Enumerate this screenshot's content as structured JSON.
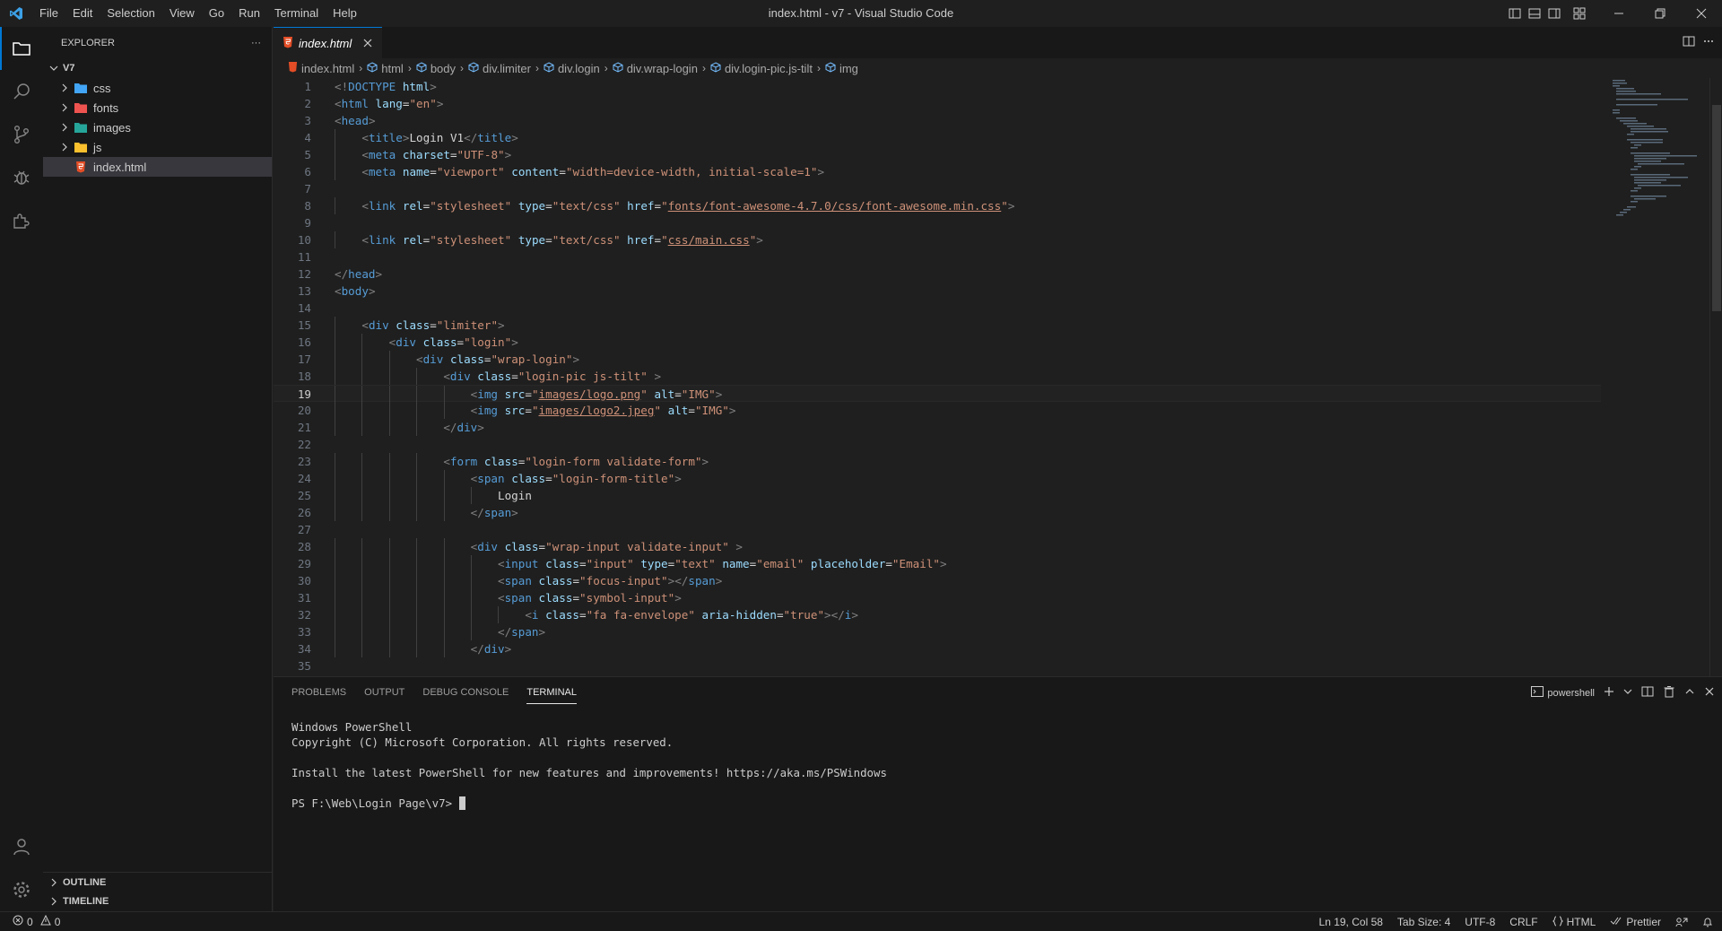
{
  "window": {
    "title": "index.html - v7 - Visual Studio Code",
    "menu": [
      "File",
      "Edit",
      "Selection",
      "View",
      "Go",
      "Run",
      "Terminal",
      "Help"
    ]
  },
  "sidebar": {
    "header": "EXPLORER",
    "more": "···",
    "root": "V7",
    "items": [
      {
        "label": "css",
        "icon": "css-folder-icon",
        "color": "#42a5f5"
      },
      {
        "label": "fonts",
        "icon": "fonts-folder-icon",
        "color": "#ef5350"
      },
      {
        "label": "images",
        "icon": "images-folder-icon",
        "color": "#26a69a"
      },
      {
        "label": "js",
        "icon": "js-folder-icon",
        "color": "#fbc02d"
      },
      {
        "label": "index.html",
        "icon": "html-file-icon",
        "color": "#e44d26"
      }
    ],
    "outline": "OUTLINE",
    "timeline": "TIMELINE"
  },
  "editor": {
    "tab_label": "index.html",
    "breadcrumbs": [
      "index.html",
      "html",
      "body",
      "div.limiter",
      "div.login",
      "div.wrap-login",
      "div.login-pic.js-tilt",
      "img"
    ],
    "current_line": 19,
    "lines": [
      {
        "n": "1",
        "indent": 0,
        "tokens": [
          [
            "tag",
            "<!"
          ],
          [
            "name",
            "DOCTYPE"
          ],
          [
            "text",
            " "
          ],
          [
            "attr",
            "html"
          ],
          [
            "tag",
            ">"
          ]
        ]
      },
      {
        "n": "2",
        "indent": 0,
        "tokens": [
          [
            "tag",
            "<"
          ],
          [
            "name",
            "html"
          ],
          [
            "text",
            " "
          ],
          [
            "attr",
            "lang"
          ],
          [
            "text",
            "="
          ],
          [
            "str",
            "\"en\""
          ],
          [
            "tag",
            ">"
          ]
        ]
      },
      {
        "n": "3",
        "indent": 0,
        "tokens": [
          [
            "tag",
            "<"
          ],
          [
            "name",
            "head"
          ],
          [
            "tag",
            ">"
          ]
        ]
      },
      {
        "n": "4",
        "indent": 1,
        "tokens": [
          [
            "tag",
            "<"
          ],
          [
            "name",
            "title"
          ],
          [
            "tag",
            ">"
          ],
          [
            "text",
            "Login V1"
          ],
          [
            "tag",
            "</"
          ],
          [
            "name",
            "title"
          ],
          [
            "tag",
            ">"
          ]
        ]
      },
      {
        "n": "5",
        "indent": 1,
        "tokens": [
          [
            "tag",
            "<"
          ],
          [
            "name",
            "meta"
          ],
          [
            "text",
            " "
          ],
          [
            "attr",
            "charset"
          ],
          [
            "text",
            "="
          ],
          [
            "str",
            "\"UTF-8\""
          ],
          [
            "tag",
            ">"
          ]
        ]
      },
      {
        "n": "6",
        "indent": 1,
        "tokens": [
          [
            "tag",
            "<"
          ],
          [
            "name",
            "meta"
          ],
          [
            "text",
            " "
          ],
          [
            "attr",
            "name"
          ],
          [
            "text",
            "="
          ],
          [
            "str",
            "\"viewport\""
          ],
          [
            "text",
            " "
          ],
          [
            "attr",
            "content"
          ],
          [
            "text",
            "="
          ],
          [
            "str",
            "\"width=device-width, initial-scale=1\""
          ],
          [
            "tag",
            ">"
          ]
        ]
      },
      {
        "n": "7",
        "indent": 0,
        "tokens": []
      },
      {
        "n": "8",
        "indent": 1,
        "tokens": [
          [
            "tag",
            "<"
          ],
          [
            "name",
            "link"
          ],
          [
            "text",
            " "
          ],
          [
            "attr",
            "rel"
          ],
          [
            "text",
            "="
          ],
          [
            "str",
            "\"stylesheet\""
          ],
          [
            "text",
            " "
          ],
          [
            "attr",
            "type"
          ],
          [
            "text",
            "="
          ],
          [
            "str",
            "\"text/css\""
          ],
          [
            "text",
            " "
          ],
          [
            "attr",
            "href"
          ],
          [
            "text",
            "="
          ],
          [
            "str",
            "\""
          ],
          [
            "link",
            "fonts/font-awesome-4.7.0/css/font-awesome.min.css"
          ],
          [
            "str",
            "\""
          ],
          [
            "tag",
            ">"
          ]
        ]
      },
      {
        "n": "9",
        "indent": 0,
        "tokens": []
      },
      {
        "n": "10",
        "indent": 1,
        "tokens": [
          [
            "tag",
            "<"
          ],
          [
            "name",
            "link"
          ],
          [
            "text",
            " "
          ],
          [
            "attr",
            "rel"
          ],
          [
            "text",
            "="
          ],
          [
            "str",
            "\"stylesheet\""
          ],
          [
            "text",
            " "
          ],
          [
            "attr",
            "type"
          ],
          [
            "text",
            "="
          ],
          [
            "str",
            "\"text/css\""
          ],
          [
            "text",
            " "
          ],
          [
            "attr",
            "href"
          ],
          [
            "text",
            "="
          ],
          [
            "str",
            "\""
          ],
          [
            "link",
            "css/main.css"
          ],
          [
            "str",
            "\""
          ],
          [
            "tag",
            ">"
          ]
        ]
      },
      {
        "n": "11",
        "indent": 0,
        "tokens": []
      },
      {
        "n": "12",
        "indent": 0,
        "tokens": [
          [
            "tag",
            "</"
          ],
          [
            "name",
            "head"
          ],
          [
            "tag",
            ">"
          ]
        ]
      },
      {
        "n": "13",
        "indent": 0,
        "tokens": [
          [
            "tag",
            "<"
          ],
          [
            "name",
            "body"
          ],
          [
            "tag",
            ">"
          ]
        ]
      },
      {
        "n": "14",
        "indent": 0,
        "tokens": []
      },
      {
        "n": "15",
        "indent": 1,
        "tokens": [
          [
            "tag",
            "<"
          ],
          [
            "name",
            "div"
          ],
          [
            "text",
            " "
          ],
          [
            "attr",
            "class"
          ],
          [
            "text",
            "="
          ],
          [
            "str",
            "\"limiter\""
          ],
          [
            "tag",
            ">"
          ]
        ]
      },
      {
        "n": "16",
        "indent": 2,
        "tokens": [
          [
            "tag",
            "<"
          ],
          [
            "name",
            "div"
          ],
          [
            "text",
            " "
          ],
          [
            "attr",
            "class"
          ],
          [
            "text",
            "="
          ],
          [
            "str",
            "\"login\""
          ],
          [
            "tag",
            ">"
          ]
        ]
      },
      {
        "n": "17",
        "indent": 3,
        "tokens": [
          [
            "tag",
            "<"
          ],
          [
            "name",
            "div"
          ],
          [
            "text",
            " "
          ],
          [
            "attr",
            "class"
          ],
          [
            "text",
            "="
          ],
          [
            "str",
            "\"wrap-login\""
          ],
          [
            "tag",
            ">"
          ]
        ]
      },
      {
        "n": "18",
        "indent": 4,
        "tokens": [
          [
            "tag",
            "<"
          ],
          [
            "name",
            "div"
          ],
          [
            "text",
            " "
          ],
          [
            "attr",
            "class"
          ],
          [
            "text",
            "="
          ],
          [
            "str",
            "\"login-pic js-tilt\""
          ],
          [
            "text",
            " "
          ],
          [
            "tag",
            ">"
          ]
        ]
      },
      {
        "n": "19",
        "indent": 5,
        "tokens": [
          [
            "tag",
            "<"
          ],
          [
            "name",
            "img"
          ],
          [
            "text",
            " "
          ],
          [
            "attr",
            "src"
          ],
          [
            "text",
            "="
          ],
          [
            "str",
            "\""
          ],
          [
            "link",
            "images/logo.png"
          ],
          [
            "str",
            "\""
          ],
          [
            "text",
            " "
          ],
          [
            "attr",
            "alt"
          ],
          [
            "text",
            "="
          ],
          [
            "str",
            "\"IMG\""
          ],
          [
            "tag",
            ">"
          ]
        ]
      },
      {
        "n": "20",
        "indent": 5,
        "tokens": [
          [
            "tag",
            "<"
          ],
          [
            "name",
            "img"
          ],
          [
            "text",
            " "
          ],
          [
            "attr",
            "src"
          ],
          [
            "text",
            "="
          ],
          [
            "str",
            "\""
          ],
          [
            "link",
            "images/logo2.jpeg"
          ],
          [
            "str",
            "\""
          ],
          [
            "text",
            " "
          ],
          [
            "attr",
            "alt"
          ],
          [
            "text",
            "="
          ],
          [
            "str",
            "\"IMG\""
          ],
          [
            "tag",
            ">"
          ]
        ]
      },
      {
        "n": "21",
        "indent": 4,
        "tokens": [
          [
            "tag",
            "</"
          ],
          [
            "name",
            "div"
          ],
          [
            "tag",
            ">"
          ]
        ]
      },
      {
        "n": "22",
        "indent": 0,
        "tokens": []
      },
      {
        "n": "23",
        "indent": 4,
        "tokens": [
          [
            "tag",
            "<"
          ],
          [
            "name",
            "form"
          ],
          [
            "text",
            " "
          ],
          [
            "attr",
            "class"
          ],
          [
            "text",
            "="
          ],
          [
            "str",
            "\"login-form validate-form\""
          ],
          [
            "tag",
            ">"
          ]
        ]
      },
      {
        "n": "24",
        "indent": 5,
        "tokens": [
          [
            "tag",
            "<"
          ],
          [
            "name",
            "span"
          ],
          [
            "text",
            " "
          ],
          [
            "attr",
            "class"
          ],
          [
            "text",
            "="
          ],
          [
            "str",
            "\"login-form-title\""
          ],
          [
            "tag",
            ">"
          ]
        ]
      },
      {
        "n": "25",
        "indent": 6,
        "tokens": [
          [
            "text",
            "Login"
          ]
        ]
      },
      {
        "n": "26",
        "indent": 5,
        "tokens": [
          [
            "tag",
            "</"
          ],
          [
            "name",
            "span"
          ],
          [
            "tag",
            ">"
          ]
        ]
      },
      {
        "n": "27",
        "indent": 0,
        "tokens": []
      },
      {
        "n": "28",
        "indent": 5,
        "tokens": [
          [
            "tag",
            "<"
          ],
          [
            "name",
            "div"
          ],
          [
            "text",
            " "
          ],
          [
            "attr",
            "class"
          ],
          [
            "text",
            "="
          ],
          [
            "str",
            "\"wrap-input validate-input\""
          ],
          [
            "text",
            " "
          ],
          [
            "tag",
            ">"
          ]
        ]
      },
      {
        "n": "29",
        "indent": 6,
        "tokens": [
          [
            "tag",
            "<"
          ],
          [
            "name",
            "input"
          ],
          [
            "text",
            " "
          ],
          [
            "attr",
            "class"
          ],
          [
            "text",
            "="
          ],
          [
            "str",
            "\"input\""
          ],
          [
            "text",
            " "
          ],
          [
            "attr",
            "type"
          ],
          [
            "text",
            "="
          ],
          [
            "str",
            "\"text\""
          ],
          [
            "text",
            " "
          ],
          [
            "attr",
            "name"
          ],
          [
            "text",
            "="
          ],
          [
            "str",
            "\"email\""
          ],
          [
            "text",
            " "
          ],
          [
            "attr",
            "placeholder"
          ],
          [
            "text",
            "="
          ],
          [
            "str",
            "\"Email\""
          ],
          [
            "tag",
            ">"
          ]
        ]
      },
      {
        "n": "30",
        "indent": 6,
        "tokens": [
          [
            "tag",
            "<"
          ],
          [
            "name",
            "span"
          ],
          [
            "text",
            " "
          ],
          [
            "attr",
            "class"
          ],
          [
            "text",
            "="
          ],
          [
            "str",
            "\"focus-input\""
          ],
          [
            "tag",
            "></"
          ],
          [
            "name",
            "span"
          ],
          [
            "tag",
            ">"
          ]
        ]
      },
      {
        "n": "31",
        "indent": 6,
        "tokens": [
          [
            "tag",
            "<"
          ],
          [
            "name",
            "span"
          ],
          [
            "text",
            " "
          ],
          [
            "attr",
            "class"
          ],
          [
            "text",
            "="
          ],
          [
            "str",
            "\"symbol-input\""
          ],
          [
            "tag",
            ">"
          ]
        ]
      },
      {
        "n": "32",
        "indent": 7,
        "tokens": [
          [
            "tag",
            "<"
          ],
          [
            "name",
            "i"
          ],
          [
            "text",
            " "
          ],
          [
            "attr",
            "class"
          ],
          [
            "text",
            "="
          ],
          [
            "str",
            "\"fa fa-envelope\""
          ],
          [
            "text",
            " "
          ],
          [
            "attr",
            "aria-hidden"
          ],
          [
            "text",
            "="
          ],
          [
            "str",
            "\"true\""
          ],
          [
            "tag",
            "></"
          ],
          [
            "name",
            "i"
          ],
          [
            "tag",
            ">"
          ]
        ]
      },
      {
        "n": "33",
        "indent": 6,
        "tokens": [
          [
            "tag",
            "</"
          ],
          [
            "name",
            "span"
          ],
          [
            "tag",
            ">"
          ]
        ]
      },
      {
        "n": "34",
        "indent": 5,
        "tokens": [
          [
            "tag",
            "</"
          ],
          [
            "name",
            "div"
          ],
          [
            "tag",
            ">"
          ]
        ]
      },
      {
        "n": "35",
        "indent": 0,
        "tokens": []
      }
    ]
  },
  "panel": {
    "tabs": [
      "PROBLEMS",
      "OUTPUT",
      "DEBUG CONSOLE",
      "TERMINAL"
    ],
    "active_tab": "TERMINAL",
    "shell": "powershell",
    "terminal_lines": [
      "Windows PowerShell",
      "Copyright (C) Microsoft Corporation. All rights reserved.",
      "",
      "Install the latest PowerShell for new features and improvements! https://aka.ms/PSWindows",
      ""
    ],
    "prompt": "PS F:\\Web\\Login Page\\v7> "
  },
  "status": {
    "errors": "0",
    "warnings": "0",
    "position": "Ln 19, Col 58",
    "tab_size": "Tab Size: 4",
    "encoding": "UTF-8",
    "eol": "CRLF",
    "language": "HTML",
    "formatter": "Prettier"
  },
  "colors": {
    "accent": "#0078d4",
    "background": "#1f1f1f",
    "sidebar": "#181818"
  }
}
